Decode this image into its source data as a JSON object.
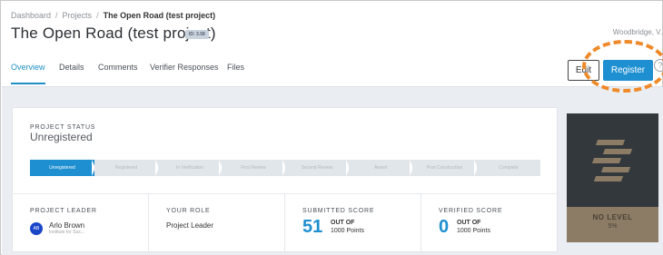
{
  "breadcrumb": {
    "items": [
      "Dashboard",
      "Projects"
    ],
    "current": "The Open Road (test project)"
  },
  "header": {
    "title": "The Open Road (test project)",
    "badge": "ID: 3.58",
    "location": "Woodbridge, V."
  },
  "tabs": [
    {
      "label": "Overview",
      "active": true
    },
    {
      "label": "Details",
      "active": false
    },
    {
      "label": "Comments",
      "active": false
    },
    {
      "label": "Verifier Responses",
      "active": false
    },
    {
      "label": "Files",
      "active": false
    }
  ],
  "actions": {
    "edit_label": "Edit",
    "register_label": "Register",
    "help_glyph": "?"
  },
  "status": {
    "label": "PROJECT STATUS",
    "value": "Unregistered",
    "steps": [
      {
        "label": "Unregistered",
        "active": true
      },
      {
        "label": "Registered",
        "active": false
      },
      {
        "label": "In Verification",
        "active": false
      },
      {
        "label": "First Review",
        "active": false
      },
      {
        "label": "Second Review",
        "active": false
      },
      {
        "label": "Award",
        "active": false
      },
      {
        "label": "Post Construction",
        "active": false
      },
      {
        "label": "Complete",
        "active": false
      }
    ]
  },
  "summary": {
    "leader": {
      "label": "PROJECT LEADER",
      "initials": "AB",
      "name": "Arlo Brown",
      "org": "Institute for Sus..."
    },
    "role": {
      "label": "YOUR ROLE",
      "value": "Project Leader"
    },
    "submitted": {
      "label": "SUBMITTED SCORE",
      "value": "51",
      "out_of": "OUT OF",
      "points": "1000 Points"
    },
    "verified": {
      "label": "VERIFIED SCORE",
      "value": "0",
      "out_of": "OUT OF",
      "points": "1000 Points"
    }
  },
  "level": {
    "label": "NO LEVEL",
    "percent": "5%"
  },
  "colors": {
    "accent": "#1e8fd0",
    "annotation": "#ef8a2a",
    "level_panel": "#33383d",
    "level_bronze": "#8c7c66"
  }
}
